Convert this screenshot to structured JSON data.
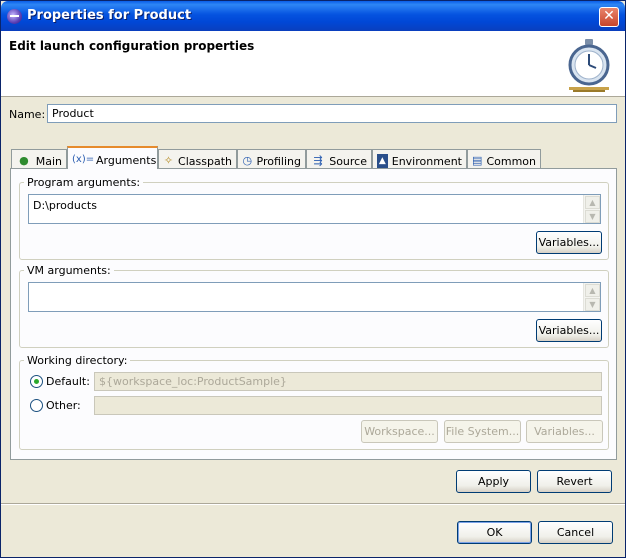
{
  "window": {
    "title": "Properties for Product",
    "close_glyph": "✕"
  },
  "header": {
    "title": "Edit launch configuration properties"
  },
  "name": {
    "label": "Name:",
    "value": "Product"
  },
  "tabs": [
    {
      "label": "Main",
      "icon": "main-tab-icon"
    },
    {
      "label": "Arguments",
      "icon": "arguments-tab-icon"
    },
    {
      "label": "Classpath",
      "icon": "classpath-tab-icon"
    },
    {
      "label": "Profiling",
      "icon": "profiling-tab-icon"
    },
    {
      "label": "Source",
      "icon": "source-tab-icon"
    },
    {
      "label": "Environment",
      "icon": "environment-tab-icon"
    },
    {
      "label": "Common",
      "icon": "common-tab-icon"
    }
  ],
  "active_tab": "Arguments",
  "program_args": {
    "title": "Program arguments:",
    "value": "D:\\products",
    "variables_label": "Variables..."
  },
  "vm_args": {
    "title": "VM arguments:",
    "value": "",
    "variables_label": "Variables..."
  },
  "working_dir": {
    "title": "Working directory:",
    "default_label": "Default:",
    "default_value": "${workspace_loc:ProductSample}",
    "other_label": "Other:",
    "other_value": "",
    "selected": "default",
    "workspace_label": "Workspace...",
    "filesystem_label": "File System...",
    "variables_label": "Variables..."
  },
  "actions": {
    "apply": "Apply",
    "revert": "Revert",
    "ok": "OK",
    "cancel": "Cancel"
  },
  "colors": {
    "titlebar": "#0553e0",
    "active_tab_accent": "#e68b2c",
    "dialog_bg": "#ece9d8"
  }
}
